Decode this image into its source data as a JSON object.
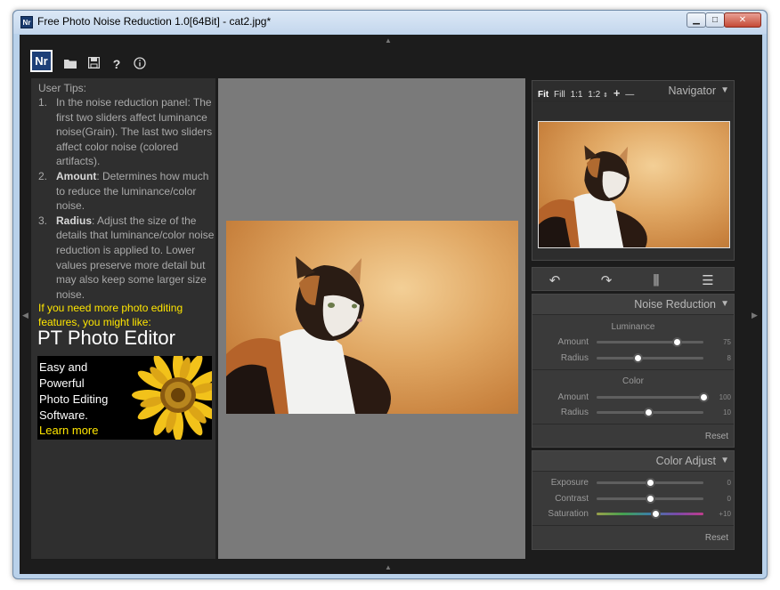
{
  "window": {
    "icon_text": "Nr",
    "title": "Free Photo Noise Reduction 1.0[64Bit] - cat2.jpg*",
    "minimize": "▁",
    "maximize": "□",
    "close": "✕"
  },
  "toolbar": {
    "logo": "Nr",
    "icons": [
      "folder-icon",
      "save-icon",
      "help-icon",
      "info-icon"
    ],
    "open_glyph": "▬",
    "save_glyph": "▣",
    "help_glyph": "?",
    "info_glyph": "ⓘ"
  },
  "tips": {
    "title": "User Tips:",
    "items": [
      {
        "num": "1.",
        "bold": "",
        "text": "In the noise reduction panel: The first two sliders affect luminance noise(Grain). The last two sliders affect color noise (colored artifacts)."
      },
      {
        "num": "2.",
        "bold": "Amount",
        "text": ": Determines how much to reduce the luminance/color noise."
      },
      {
        "num": "3.",
        "bold": "Radius",
        "text": ": Adjust the size of the details that luminance/color noise reduction is applied to. Lower values preserve more detail but may also keep some larger size noise."
      }
    ],
    "promo": "If you need more photo editing features, you might like:",
    "product": "PT Photo Editor",
    "ad_lines": [
      "Easy and",
      "Powerful",
      "Photo Editing",
      "Software."
    ],
    "ad_link": "Learn more"
  },
  "navigator": {
    "title": "Navigator",
    "fit": "Fit",
    "fill": "Fill",
    "one_to_one": "1:1",
    "one_to_two": "1:2",
    "zoom_in": "+",
    "zoom_out": "—"
  },
  "noise_reduction": {
    "title": "Noise Reduction",
    "luminance_label": "Luminance",
    "color_label": "Color",
    "sliders": [
      {
        "label": "Amount",
        "value": "75",
        "level": 0.75
      },
      {
        "label": "Radius",
        "value": "8",
        "level": 0.38
      },
      {
        "label": "Amount",
        "value": "100",
        "level": 1.0
      },
      {
        "label": "Radius",
        "value": "10",
        "level": 0.48
      }
    ],
    "reset": "Reset"
  },
  "color_adjust": {
    "title": "Color Adjust",
    "sliders": [
      {
        "label": "Exposure",
        "value": "0",
        "level": 0.5
      },
      {
        "label": "Contrast",
        "value": "0",
        "level": 0.5
      },
      {
        "label": "Saturation",
        "value": "+10",
        "level": 0.55
      }
    ],
    "reset": "Reset"
  },
  "colors": {
    "frame": "#b9d1ea",
    "panel": "#2f2f2f",
    "canvas": "#7a7a7a",
    "promo": "#ffe600"
  }
}
